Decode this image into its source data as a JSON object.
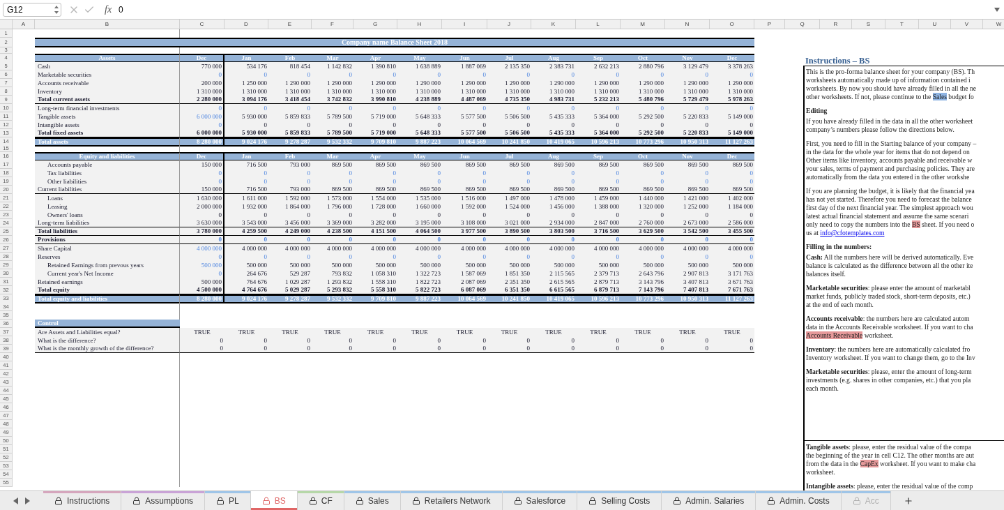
{
  "formula_bar": {
    "cell_ref": "G12",
    "function_label": "fx",
    "value": "0"
  },
  "column_headers": [
    "A",
    "B",
    "C",
    "D",
    "E",
    "F",
    "G",
    "H",
    "I",
    "J",
    "K",
    "L",
    "M",
    "N",
    "O",
    "P",
    "Q",
    "R",
    "S",
    "T",
    "U",
    "V",
    "W"
  ],
  "row_numbers": [
    "1",
    "2",
    "3",
    "4",
    "5",
    "6",
    "7",
    "8",
    "9",
    "10",
    "11",
    "12",
    "13",
    "14",
    "15",
    "16",
    "17",
    "18",
    "19",
    "20",
    "21",
    "22",
    "23",
    "24",
    "25",
    "26",
    "27",
    "28",
    "29",
    "30",
    "31",
    "32",
    "33",
    "34",
    "35",
    "36",
    "37",
    "38",
    "39",
    "40",
    "41",
    "42",
    "43",
    "44",
    "45",
    "46",
    "47",
    "48",
    "49",
    "50",
    "51",
    "52",
    "53",
    "54",
    "55"
  ],
  "sheet_title": "Company name Balance Sheet 2018",
  "assets_table": {
    "label": "Assets",
    "months": [
      "Dec",
      "Jan",
      "Feb",
      "Mar",
      "Apr",
      "May",
      "Jun",
      "Jul",
      "Aug",
      "Sep",
      "Oct",
      "Nov",
      "Dec"
    ],
    "rows": [
      {
        "label": "Cash",
        "kind": "item",
        "input_opening": false,
        "input_months": false,
        "values": [
          "770 000",
          "534 176",
          "818 454",
          "1 142 832",
          "1 390 810",
          "1 638 889",
          "1 887 069",
          "2 135 350",
          "2 383 731",
          "2 632 213",
          "2 880 796",
          "3 129 479",
          "3 378 263"
        ]
      },
      {
        "label": "Marketable securities",
        "kind": "item",
        "input_opening": true,
        "input_months": true,
        "values": [
          "0",
          "0",
          "0",
          "0",
          "0",
          "0",
          "0",
          "0",
          "0",
          "0",
          "0",
          "0",
          "0"
        ]
      },
      {
        "label": "Accounts receivable",
        "kind": "item",
        "input_opening": false,
        "input_months": false,
        "values": [
          "200 000",
          "1 250 000",
          "1 290 000",
          "1 290 000",
          "1 290 000",
          "1 290 000",
          "1 290 000",
          "1 290 000",
          "1 290 000",
          "1 290 000",
          "1 290 000",
          "1 290 000",
          "1 290 000"
        ]
      },
      {
        "label": "Inventory",
        "kind": "item",
        "input_opening": false,
        "input_months": false,
        "values": [
          "1 310 000",
          "1 310 000",
          "1 310 000",
          "1 310 000",
          "1 310 000",
          "1 310 000",
          "1 310 000",
          "1 310 000",
          "1 310 000",
          "1 310 000",
          "1 310 000",
          "1 310 000",
          "1 310 000"
        ]
      },
      {
        "label": "Total current assets",
        "kind": "subtotal",
        "input_opening": false,
        "input_months": false,
        "values": [
          "2 280 000",
          "3 094 176",
          "3 418 454",
          "3 742 832",
          "3 990 810",
          "4 238 889",
          "4 487 069",
          "4 735 350",
          "4 983 731",
          "5 232 213",
          "5 480 796",
          "5 729 479",
          "5 978 263"
        ]
      },
      {
        "label": "Long-term financial investments",
        "kind": "item",
        "input_opening": true,
        "input_months": true,
        "values": [
          "0",
          "0",
          "0",
          "0",
          "0",
          "0",
          "0",
          "0",
          "0",
          "0",
          "0",
          "0",
          "0"
        ]
      },
      {
        "label": "Tangible assets",
        "kind": "item",
        "input_opening": true,
        "input_months": false,
        "values": [
          "6 000 000",
          "5 930 000",
          "5 859 833",
          "5 789 500",
          "5 719 000",
          "5 648 333",
          "5 577 500",
          "5 506 500",
          "5 435 333",
          "5 364 000",
          "5 292 500",
          "5 220 833",
          "5 149 000"
        ]
      },
      {
        "label": "Intangible assets",
        "kind": "item",
        "input_opening": true,
        "input_months": false,
        "values": [
          "0",
          "0",
          "0",
          "0",
          "0",
          "0",
          "0",
          "0",
          "0",
          "0",
          "0",
          "0",
          "0"
        ]
      },
      {
        "label": "Total fixed assets",
        "kind": "subtotal",
        "input_opening": false,
        "input_months": false,
        "values": [
          "6 000 000",
          "5 930 000",
          "5 859 833",
          "5 789 500",
          "5 719 000",
          "5 648 333",
          "5 577 500",
          "5 506 500",
          "5 435 333",
          "5 364 000",
          "5 292 500",
          "5 220 833",
          "5 149 000"
        ]
      },
      {
        "label": "Total assets",
        "kind": "grand_total",
        "input_opening": false,
        "input_months": false,
        "values": [
          "8 280 000",
          "9 024 176",
          "9 278 287",
          "9 532 332",
          "9 709 810",
          "9 887 223",
          "10 064 569",
          "10 241 850",
          "10 419 065",
          "10 596 213",
          "10 773 296",
          "10 950 313",
          "11 127 263"
        ]
      }
    ]
  },
  "equity_table": {
    "label": "Equity and liabilities",
    "months": [
      "Dec",
      "Jan",
      "Feb",
      "Mar",
      "Apr",
      "May",
      "Jun",
      "Jul",
      "Aug",
      "Sep",
      "Oct",
      "Nov",
      "Dec"
    ],
    "rows": [
      {
        "label": "Accounts payable",
        "kind": "sub_item",
        "input_opening": false,
        "input_months": false,
        "values": [
          "150 000",
          "716 500",
          "793 000",
          "869 500",
          "869 500",
          "869 500",
          "869 500",
          "869 500",
          "869 500",
          "869 500",
          "869 500",
          "869 500",
          "869 500"
        ]
      },
      {
        "label": "Tax liabilities",
        "kind": "sub_item",
        "input_opening": true,
        "input_months": true,
        "values": [
          "0",
          "0",
          "0",
          "0",
          "0",
          "0",
          "0",
          "0",
          "0",
          "0",
          "0",
          "0",
          "0"
        ]
      },
      {
        "label": "Other liabilities",
        "kind": "sub_item",
        "input_opening": true,
        "input_months": true,
        "values": [
          "0",
          "0",
          "0",
          "0",
          "0",
          "0",
          "0",
          "0",
          "0",
          "0",
          "0",
          "0",
          "0"
        ]
      },
      {
        "label": "Current liabilities",
        "kind": "group_total",
        "input_opening": false,
        "input_months": false,
        "values": [
          "150 000",
          "716 500",
          "793 000",
          "869 500",
          "869 500",
          "869 500",
          "869 500",
          "869 500",
          "869 500",
          "869 500",
          "869 500",
          "869 500",
          "869 500"
        ]
      },
      {
        "label": "Loans",
        "kind": "sub_item",
        "input_opening": false,
        "input_months": false,
        "values": [
          "1 630 000",
          "1 611 000",
          "1 592 000",
          "1 573 000",
          "1 554 000",
          "1 535 000",
          "1 516 000",
          "1 497 000",
          "1 478 000",
          "1 459 000",
          "1 440 000",
          "1 421 000",
          "1 402 000"
        ]
      },
      {
        "label": "Leasing",
        "kind": "sub_item",
        "input_opening": false,
        "input_months": false,
        "values": [
          "2 000 000",
          "1 932 000",
          "1 864 000",
          "1 796 000",
          "1 728 000",
          "1 660 000",
          "1 592 000",
          "1 524 000",
          "1 456 000",
          "1 388 000",
          "1 320 000",
          "1 252 000",
          "1 184 000"
        ]
      },
      {
        "label": "Owners' loans",
        "kind": "sub_item",
        "input_opening": false,
        "input_months": false,
        "values": [
          "0",
          "0",
          "0",
          "0",
          "0",
          "0",
          "0",
          "0",
          "0",
          "0",
          "0",
          "0",
          "0"
        ]
      },
      {
        "label": "Long-term liabilities",
        "kind": "group_total",
        "input_opening": false,
        "input_months": false,
        "values": [
          "3 630 000",
          "3 543 000",
          "3 456 000",
          "3 369 000",
          "3 282 000",
          "3 195 000",
          "3 108 000",
          "3 021 000",
          "2 934 000",
          "2 847 000",
          "2 760 000",
          "2 673 000",
          "2 586 000"
        ]
      },
      {
        "label": "Total liabilities",
        "kind": "subtotal",
        "input_opening": false,
        "input_months": false,
        "values": [
          "3 780 000",
          "4 259 500",
          "4 249 000",
          "4 238 500",
          "4 151 500",
          "4 064 500",
          "3 977 500",
          "3 890 500",
          "3 803 500",
          "3 716 500",
          "3 629 500",
          "3 542 500",
          "3 455 500"
        ]
      },
      {
        "label": "Provisions",
        "kind": "subtotal",
        "input_opening": true,
        "input_months": true,
        "values": [
          "0",
          "0",
          "0",
          "0",
          "0",
          "0",
          "0",
          "0",
          "0",
          "0",
          "0",
          "0",
          "0"
        ]
      },
      {
        "label": "Share Capital",
        "kind": "item",
        "input_opening": true,
        "input_months": false,
        "values": [
          "4 000 000",
          "4 000 000",
          "4 000 000",
          "4 000 000",
          "4 000 000",
          "4 000 000",
          "4 000 000",
          "4 000 000",
          "4 000 000",
          "4 000 000",
          "4 000 000",
          "4 000 000",
          "4 000 000"
        ]
      },
      {
        "label": "Reserves",
        "kind": "item",
        "input_opening": true,
        "input_months": true,
        "values": [
          "0",
          "0",
          "0",
          "0",
          "0",
          "0",
          "0",
          "0",
          "0",
          "0",
          "0",
          "0",
          "0"
        ]
      },
      {
        "label": "Retained Earnings from prevous years",
        "kind": "sub_item",
        "input_opening": true,
        "input_months": false,
        "values": [
          "500 000",
          "500 000",
          "500 000",
          "500 000",
          "500 000",
          "500 000",
          "500 000",
          "500 000",
          "500 000",
          "500 000",
          "500 000",
          "500 000",
          "500 000"
        ]
      },
      {
        "label": "Current year's Net Income",
        "kind": "sub_item",
        "input_opening": true,
        "input_months": false,
        "values": [
          "0",
          "264 676",
          "529 287",
          "793 832",
          "1 058 310",
          "1 322 723",
          "1 587 069",
          "1 851 350",
          "2 115 565",
          "2 379 713",
          "2 643 796",
          "2 907 813",
          "3 171 763"
        ]
      },
      {
        "label": "Retained earnings",
        "kind": "item",
        "input_opening": false,
        "input_months": false,
        "values": [
          "500 000",
          "764 676",
          "1 029 287",
          "1 293 832",
          "1 558 310",
          "1 822 723",
          "2 087 069",
          "2 351 350",
          "2 615 565",
          "2 879 713",
          "3 143 796",
          "3 407 813",
          "3 671 763"
        ]
      },
      {
        "label": "Total equity",
        "kind": "subtotal",
        "input_opening": false,
        "input_months": false,
        "values": [
          "4 500 000",
          "4 764 676",
          "5 029 287",
          "5 293 832",
          "5 558 310",
          "5 822 723",
          "6 087 069",
          "6 351 350",
          "6 615 565",
          "6 879 713",
          "7 143 796",
          "7 407 813",
          "7 671 763"
        ]
      },
      {
        "label": "Total equity and liabilities",
        "kind": "grand_total",
        "input_opening": false,
        "input_months": false,
        "values": [
          "8 280 000",
          "9 024 176",
          "9 278 287",
          "9 532 332",
          "9 709 810",
          "9 887 223",
          "10 064 569",
          "10 241 850",
          "10 419 065",
          "10 596 213",
          "10 773 296",
          "10 950 313",
          "11 127 263"
        ]
      }
    ]
  },
  "control": {
    "label": "Control",
    "rows": [
      {
        "label": "Are Assets and Liabilities equal?",
        "kind": "check",
        "values": [
          "TRUE",
          "TRUE",
          "TRUE",
          "TRUE",
          "TRUE",
          "TRUE",
          "TRUE",
          "TRUE",
          "TRUE",
          "TRUE",
          "TRUE",
          "TRUE",
          "TRUE"
        ]
      },
      {
        "label": "What is the difference?",
        "kind": "number",
        "values": [
          "0",
          "0",
          "0",
          "0",
          "0",
          "0",
          "0",
          "0",
          "0",
          "0",
          "0",
          "0",
          "0"
        ]
      },
      {
        "label": "What is the monthly growth of the difference?",
        "kind": "number",
        "values": [
          "0",
          "0",
          "0",
          "0",
          "0",
          "0",
          "0",
          "0",
          "0",
          "0",
          "0",
          "0",
          "0"
        ]
      }
    ]
  },
  "instructions": {
    "title": "Instructions – BS",
    "boxes": [
      {
        "blocks": [
          {
            "kind": "paragraph",
            "lines": [
              [
                {
                  "kind": "text",
                  "text": "This is the pro-forma balance sheet for your company (BS). Th"
                }
              ],
              [
                {
                  "kind": "text",
                  "text": "worksheets automatically made up of information contained i"
                }
              ],
              [
                {
                  "kind": "text",
                  "text": "worksheets. By now you should have already filled in all the ne"
                }
              ],
              [
                {
                  "kind": "text",
                  "text": "other worksheets. If not, please continue to the "
                },
                {
                  "kind": "highlight",
                  "text": "Sales",
                  "color": "#8eb4e3"
                },
                {
                  "kind": "text",
                  "text": " budget fo"
                }
              ]
            ]
          },
          {
            "kind": "heading",
            "text": "Editing"
          },
          {
            "kind": "paragraph",
            "lines": [
              [
                {
                  "kind": "text",
                  "text": "If you have already filled in the data in all the other worksheet"
                }
              ],
              [
                {
                  "kind": "text",
                  "text": "company’s numbers please follow the directions below."
                }
              ]
            ]
          },
          {
            "kind": "paragraph",
            "lines": [
              [
                {
                  "kind": "text",
                  "text": "First, you need to fill in the Starting balance of your company –"
                }
              ],
              [
                {
                  "kind": "text",
                  "text": "in the data for the whole year for items that do not depend on"
                }
              ],
              [
                {
                  "kind": "text",
                  "text": "Other items like inventory, accounts payable and receivable w"
                }
              ],
              [
                {
                  "kind": "text",
                  "text": "your sales, terms of payment and purchasing policies. They are"
                }
              ],
              [
                {
                  "kind": "text",
                  "text": "automatically from the data you entered in the other workshe"
                }
              ]
            ]
          },
          {
            "kind": "paragraph",
            "lines": [
              [
                {
                  "kind": "text",
                  "text": "If you are planning the budget, it is likely that the financial yea"
                }
              ],
              [
                {
                  "kind": "text",
                  "text": "has not yet started. Therefore you need to forecast the balance"
                }
              ],
              [
                {
                  "kind": "text",
                  "text": "first day of the next financial year. The simplest approach wou"
                }
              ],
              [
                {
                  "kind": "text",
                  "text": "latest actual financial statement and assume the same scenari"
                }
              ],
              [
                {
                  "kind": "text",
                  "text": "only need to copy the numbers into the "
                },
                {
                  "kind": "highlight",
                  "text": "BS",
                  "color": "#e6999a"
                },
                {
                  "kind": "text",
                  "text": " sheet. If you need o"
                }
              ],
              [
                {
                  "kind": "text",
                  "text": "us at "
                },
                {
                  "kind": "link",
                  "text": "info@cfotemplates.com"
                }
              ]
            ]
          },
          {
            "kind": "heading",
            "text": "Filling in the numbers:"
          },
          {
            "kind": "paragraph",
            "lines": [
              [
                {
                  "kind": "text",
                  "text": "**Cash:** All the numbers here will be derived automatically. Eve"
                }
              ],
              [
                {
                  "kind": "text",
                  "text": "balance is calculated as the difference between all the other ite"
                }
              ],
              [
                {
                  "kind": "text",
                  "text": "balances itself."
                }
              ]
            ]
          },
          {
            "kind": "paragraph",
            "lines": [
              [
                {
                  "kind": "text",
                  "text": "**Marketable securities**: please enter the amount of marketabl"
                }
              ],
              [
                {
                  "kind": "text",
                  "text": "market funds, publicly traded stock, short-term deposits, etc.)"
                }
              ],
              [
                {
                  "kind": "text",
                  "text": "at the end of each month."
                }
              ]
            ]
          },
          {
            "kind": "paragraph",
            "lines": [
              [
                {
                  "kind": "text",
                  "text": "**Accounts receivable**: the numbers here are calculated autom"
                }
              ],
              [
                {
                  "kind": "text",
                  "text": "data in the Accounts Receivable worksheet. If you want to cha"
                }
              ],
              [
                {
                  "kind": "highlight",
                  "text": "Accounts Receivable",
                  "color": "#e6999a"
                },
                {
                  "kind": "text",
                  "text": " worksheet."
                }
              ]
            ]
          },
          {
            "kind": "paragraph",
            "lines": [
              [
                {
                  "kind": "text",
                  "text": "**Inventory**: the numbers here are automatically calculated fro"
                }
              ],
              [
                {
                  "kind": "text",
                  "text": "Inventory worksheet. If you want to change them, go to the Inv"
                }
              ]
            ]
          },
          {
            "kind": "paragraph",
            "lines": [
              [
                {
                  "kind": "text",
                  "text": "**Marketable securities**: please, enter the amount of long-term"
                }
              ],
              [
                {
                  "kind": "text",
                  "text": "investments (e.g. shares in other companies, etc.) that you pla"
                }
              ],
              [
                {
                  "kind": "text",
                  "text": "each month."
                }
              ]
            ]
          }
        ]
      },
      {
        "blocks": [
          {
            "kind": "paragraph",
            "lines": [
              [
                {
                  "kind": "text",
                  "text": "**Tangible assets**: please, enter the residual value of the compa"
                }
              ],
              [
                {
                  "kind": "text",
                  "text": "the beginning of the year in cell C12. The other months are aut"
                }
              ],
              [
                {
                  "kind": "text",
                  "text": "from the data in the "
                },
                {
                  "kind": "highlight",
                  "text": "CapEx",
                  "color": "#e6999a"
                },
                {
                  "kind": "text",
                  "text": " worksheet. If you want to make cha"
                }
              ],
              [
                {
                  "kind": "text",
                  "text": "worksheet."
                }
              ]
            ]
          },
          {
            "kind": "paragraph",
            "lines": [
              [
                {
                  "kind": "text",
                  "text": "**Intangible assets**: please, enter the residual value of the comp"
                }
              ]
            ]
          }
        ]
      }
    ]
  },
  "tabs": [
    {
      "label": "Instructions",
      "selected": false,
      "faded": false,
      "color": "#d5a6bd"
    },
    {
      "label": "Assumptions",
      "selected": false,
      "faded": false,
      "color": "#c9a3d6"
    },
    {
      "label": "PL",
      "selected": false,
      "faded": false,
      "color": "#9fc5e8"
    },
    {
      "label": "BS",
      "selected": true,
      "faded": false,
      "color": "#e06666"
    },
    {
      "label": "CF",
      "selected": false,
      "faded": false,
      "color": "#b6d7a8"
    },
    {
      "label": "Sales",
      "selected": false,
      "faded": false,
      "color": "#9fc5e8"
    },
    {
      "label": "Retailers Network",
      "selected": false,
      "faded": false,
      "color": "#9fc5e8"
    },
    {
      "label": "Salesforce",
      "selected": false,
      "faded": false,
      "color": "#9fc5e8"
    },
    {
      "label": "Selling Costs",
      "selected": false,
      "faded": false,
      "color": "#9fc5e8"
    },
    {
      "label": "Admin. Salaries",
      "selected": false,
      "faded": false,
      "color": "#9fc5e8"
    },
    {
      "label": "Admin. Costs",
      "selected": false,
      "faded": false,
      "color": "#9fc5e8"
    },
    {
      "label": "Acc",
      "selected": false,
      "faded": true,
      "color": "#9fc5e8"
    }
  ]
}
